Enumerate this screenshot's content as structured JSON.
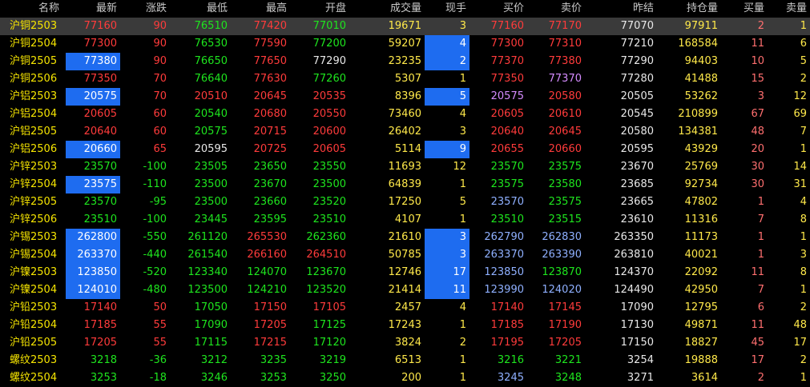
{
  "headers": {
    "name": "名称",
    "last": "最新",
    "change": "涨跌",
    "low": "最低",
    "high": "最高",
    "open": "开盘",
    "volume": "成交量",
    "hand": "现手",
    "bid": "买价",
    "ask": "卖价",
    "prev": "昨结",
    "oi": "持仓量",
    "bid_qty": "买量",
    "ask_qty": "卖量"
  },
  "rows": [
    {
      "name": "沪铜2503",
      "last": "77160",
      "change": "90",
      "low": "76510",
      "high": "77420",
      "open": "77010",
      "volume": "19671",
      "hand": "3",
      "bid": "77160",
      "ask": "77170",
      "prev": "77070",
      "oi": "97911",
      "bid_qty": "2",
      "ask_qty": "1",
      "cls": {
        "last": "up",
        "change": "up",
        "low": "down",
        "high": "up",
        "open": "down",
        "bid": "up",
        "ask": "up"
      },
      "selected": true
    },
    {
      "name": "沪铜2504",
      "last": "77300",
      "change": "90",
      "low": "76530",
      "high": "77590",
      "open": "77200",
      "volume": "59207",
      "hand": "4",
      "bid": "77300",
      "ask": "77310",
      "prev": "77210",
      "oi": "168584",
      "bid_qty": "11",
      "ask_qty": "6",
      "cls": {
        "last": "up",
        "change": "up",
        "low": "down",
        "high": "up",
        "open": "down",
        "bid": "up",
        "ask": "up"
      },
      "hl": [
        "hand"
      ]
    },
    {
      "name": "沪铜2505",
      "last": "77380",
      "change": "90",
      "low": "76650",
      "high": "77650",
      "open": "77290",
      "volume": "23235",
      "hand": "2",
      "bid": "77370",
      "ask": "77380",
      "prev": "77290",
      "oi": "94403",
      "bid_qty": "10",
      "ask_qty": "5",
      "cls": {
        "last": "up",
        "change": "up",
        "low": "down",
        "high": "up",
        "open": "flat",
        "bid": "up",
        "ask": "up"
      },
      "hl": [
        "last",
        "hand"
      ]
    },
    {
      "name": "沪铜2506",
      "last": "77350",
      "change": "70",
      "low": "76640",
      "high": "77630",
      "open": "77260",
      "volume": "5307",
      "hand": "1",
      "bid": "77350",
      "ask": "77370",
      "prev": "77280",
      "oi": "41488",
      "bid_qty": "15",
      "ask_qty": "2",
      "cls": {
        "last": "up",
        "change": "up",
        "low": "down",
        "high": "up",
        "open": "down",
        "bid": "up",
        "ask": "purple"
      }
    },
    {
      "name": "沪铝2503",
      "last": "20575",
      "change": "70",
      "low": "20510",
      "high": "20645",
      "open": "20535",
      "volume": "8396",
      "hand": "5",
      "bid": "20575",
      "ask": "20580",
      "prev": "20505",
      "oi": "53262",
      "bid_qty": "3",
      "ask_qty": "12",
      "cls": {
        "last": "up",
        "change": "up",
        "low": "up",
        "high": "up",
        "open": "up",
        "bid": "purple",
        "ask": "up"
      },
      "hl": [
        "last",
        "hand"
      ]
    },
    {
      "name": "沪铝2504",
      "last": "20605",
      "change": "60",
      "low": "20540",
      "high": "20680",
      "open": "20550",
      "volume": "73460",
      "hand": "4",
      "bid": "20605",
      "ask": "20610",
      "prev": "20545",
      "oi": "210899",
      "bid_qty": "67",
      "ask_qty": "69",
      "cls": {
        "last": "up",
        "change": "up",
        "low": "down",
        "high": "up",
        "open": "up",
        "bid": "up",
        "ask": "up"
      }
    },
    {
      "name": "沪铝2505",
      "last": "20640",
      "change": "60",
      "low": "20575",
      "high": "20715",
      "open": "20600",
      "volume": "26402",
      "hand": "3",
      "bid": "20640",
      "ask": "20645",
      "prev": "20580",
      "oi": "134381",
      "bid_qty": "48",
      "ask_qty": "7",
      "cls": {
        "last": "up",
        "change": "up",
        "low": "down",
        "high": "up",
        "open": "up",
        "bid": "up",
        "ask": "up"
      }
    },
    {
      "name": "沪铝2506",
      "last": "20660",
      "change": "65",
      "low": "20595",
      "high": "20725",
      "open": "20605",
      "volume": "5114",
      "hand": "9",
      "bid": "20655",
      "ask": "20660",
      "prev": "20595",
      "oi": "43929",
      "bid_qty": "20",
      "ask_qty": "1",
      "cls": {
        "last": "up",
        "change": "up",
        "low": "flat",
        "high": "up",
        "open": "up",
        "bid": "up",
        "ask": "up"
      },
      "hl": [
        "last",
        "hand"
      ]
    },
    {
      "name": "沪锌2503",
      "last": "23570",
      "change": "-100",
      "low": "23505",
      "high": "23650",
      "open": "23550",
      "volume": "11693",
      "hand": "12",
      "bid": "23570",
      "ask": "23575",
      "prev": "23670",
      "oi": "25769",
      "bid_qty": "30",
      "ask_qty": "14",
      "cls": {
        "last": "down",
        "change": "down",
        "low": "down",
        "high": "down",
        "open": "down",
        "bid": "down",
        "ask": "down"
      }
    },
    {
      "name": "沪锌2504",
      "last": "23575",
      "change": "-110",
      "low": "23500",
      "high": "23670",
      "open": "23500",
      "volume": "64839",
      "hand": "1",
      "bid": "23575",
      "ask": "23580",
      "prev": "23685",
      "oi": "92734",
      "bid_qty": "30",
      "ask_qty": "31",
      "cls": {
        "last": "down",
        "change": "down",
        "low": "down",
        "high": "down",
        "open": "down",
        "bid": "down",
        "ask": "down"
      },
      "hl": [
        "last"
      ]
    },
    {
      "name": "沪锌2505",
      "last": "23570",
      "change": "-95",
      "low": "23500",
      "high": "23660",
      "open": "23520",
      "volume": "17250",
      "hand": "5",
      "bid": "23570",
      "ask": "23575",
      "prev": "23665",
      "oi": "47802",
      "bid_qty": "1",
      "ask_qty": "4",
      "cls": {
        "last": "down",
        "change": "down",
        "low": "down",
        "high": "down",
        "open": "down",
        "bid": "blue",
        "ask": "down"
      }
    },
    {
      "name": "沪锌2506",
      "last": "23510",
      "change": "-100",
      "low": "23445",
      "high": "23595",
      "open": "23510",
      "volume": "4107",
      "hand": "1",
      "bid": "23510",
      "ask": "23515",
      "prev": "23610",
      "oi": "11316",
      "bid_qty": "7",
      "ask_qty": "8",
      "cls": {
        "last": "down",
        "change": "down",
        "low": "down",
        "high": "down",
        "open": "down",
        "bid": "down",
        "ask": "down"
      }
    },
    {
      "name": "沪锡2503",
      "last": "262800",
      "change": "-550",
      "low": "261120",
      "high": "265530",
      "open": "262360",
      "volume": "21610",
      "hand": "3",
      "bid": "262790",
      "ask": "262830",
      "prev": "263350",
      "oi": "11173",
      "bid_qty": "1",
      "ask_qty": "1",
      "cls": {
        "last": "down",
        "change": "down",
        "low": "down",
        "high": "up",
        "open": "down",
        "bid": "blue",
        "ask": "blue"
      },
      "hl": [
        "last",
        "hand"
      ]
    },
    {
      "name": "沪锡2504",
      "last": "263370",
      "change": "-440",
      "low": "261540",
      "high": "266160",
      "open": "264510",
      "volume": "50785",
      "hand": "3",
      "bid": "263370",
      "ask": "263390",
      "prev": "263810",
      "oi": "40021",
      "bid_qty": "1",
      "ask_qty": "3",
      "cls": {
        "last": "down",
        "change": "down",
        "low": "down",
        "high": "up",
        "open": "up",
        "bid": "blue",
        "ask": "blue"
      },
      "hl": [
        "last",
        "hand"
      ]
    },
    {
      "name": "沪镍2503",
      "last": "123850",
      "change": "-520",
      "low": "123340",
      "high": "124070",
      "open": "123670",
      "volume": "12746",
      "hand": "17",
      "bid": "123850",
      "ask": "123870",
      "prev": "124370",
      "oi": "22092",
      "bid_qty": "11",
      "ask_qty": "8",
      "cls": {
        "last": "down",
        "change": "down",
        "low": "down",
        "high": "down",
        "open": "down",
        "bid": "blue",
        "ask": "down"
      },
      "hl": [
        "last",
        "hand"
      ]
    },
    {
      "name": "沪镍2504",
      "last": "124010",
      "change": "-480",
      "low": "123500",
      "high": "124210",
      "open": "123520",
      "volume": "21414",
      "hand": "11",
      "bid": "123990",
      "ask": "124020",
      "prev": "124490",
      "oi": "42950",
      "bid_qty": "7",
      "ask_qty": "1",
      "cls": {
        "last": "down",
        "change": "down",
        "low": "down",
        "high": "down",
        "open": "down",
        "bid": "blue",
        "ask": "blue"
      },
      "hl": [
        "last",
        "hand"
      ]
    },
    {
      "name": "沪铅2503",
      "last": "17140",
      "change": "50",
      "low": "17050",
      "high": "17150",
      "open": "17105",
      "volume": "2457",
      "hand": "4",
      "bid": "17140",
      "ask": "17145",
      "prev": "17090",
      "oi": "12795",
      "bid_qty": "6",
      "ask_qty": "2",
      "cls": {
        "last": "up",
        "change": "up",
        "low": "down",
        "high": "up",
        "open": "up",
        "bid": "up",
        "ask": "up"
      }
    },
    {
      "name": "沪铅2504",
      "last": "17185",
      "change": "55",
      "low": "17090",
      "high": "17205",
      "open": "17125",
      "volume": "17243",
      "hand": "1",
      "bid": "17185",
      "ask": "17190",
      "prev": "17130",
      "oi": "49871",
      "bid_qty": "11",
      "ask_qty": "48",
      "cls": {
        "last": "up",
        "change": "up",
        "low": "down",
        "high": "up",
        "open": "down",
        "bid": "up",
        "ask": "up"
      }
    },
    {
      "name": "沪铅2505",
      "last": "17205",
      "change": "55",
      "low": "17115",
      "high": "17215",
      "open": "17120",
      "volume": "3824",
      "hand": "2",
      "bid": "17195",
      "ask": "17205",
      "prev": "17150",
      "oi": "18827",
      "bid_qty": "45",
      "ask_qty": "17",
      "cls": {
        "last": "up",
        "change": "up",
        "low": "down",
        "high": "up",
        "open": "down",
        "bid": "up",
        "ask": "up"
      }
    },
    {
      "name": "螺纹2503",
      "last": "3218",
      "change": "-36",
      "low": "3212",
      "high": "3235",
      "open": "3219",
      "volume": "6513",
      "hand": "1",
      "bid": "3216",
      "ask": "3221",
      "prev": "3254",
      "oi": "19888",
      "bid_qty": "17",
      "ask_qty": "2",
      "cls": {
        "last": "down",
        "change": "down",
        "low": "down",
        "high": "down",
        "open": "down",
        "bid": "down",
        "ask": "down"
      }
    },
    {
      "name": "螺纹2504",
      "last": "3253",
      "change": "-18",
      "low": "3246",
      "high": "3253",
      "open": "3250",
      "volume": "200",
      "hand": "1",
      "bid": "3245",
      "ask": "3248",
      "prev": "3271",
      "oi": "3614",
      "bid_qty": "2",
      "ask_qty": "1",
      "cls": {
        "last": "down",
        "change": "down",
        "low": "down",
        "high": "down",
        "open": "down",
        "bid": "blue",
        "ask": "down"
      }
    }
  ],
  "colors": {
    "up": "#ff3b3b",
    "down": "#1ee51e",
    "flat": "#e8e8e8",
    "purple": "#d58cff",
    "blue": "#8fb0ff",
    "highlight": "#1e6cf0",
    "name": "#f5e400"
  }
}
